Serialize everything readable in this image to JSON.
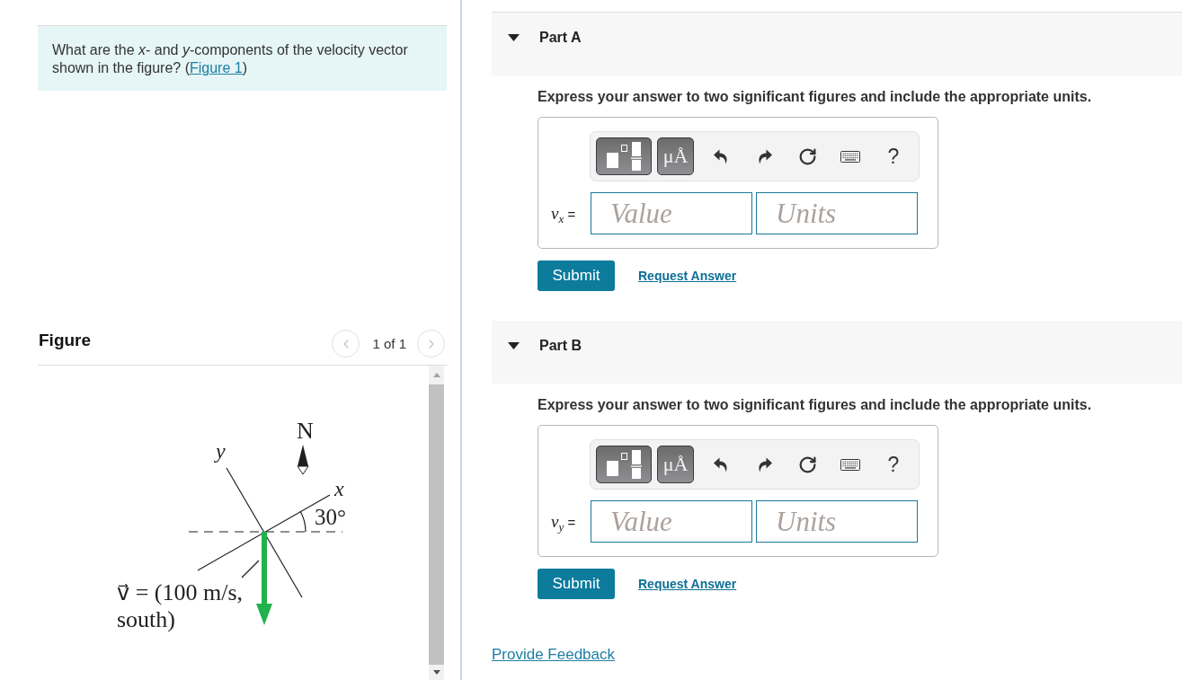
{
  "question": {
    "text_before": "What are the *x*- and *y*-components of the velocity vector shown in the figure? (",
    "link": "Figure 1",
    "text_after": ")"
  },
  "figure": {
    "title": "Figure",
    "pager": {
      "text": "1 of 1",
      "prev_disabled": true,
      "next_disabled": true
    },
    "labels": {
      "north": "N",
      "y_axis": "y",
      "x_axis": "x",
      "angle": "30°",
      "vector": {
        "symbol": "v⃗",
        "lines": [
          "= (100 m/s,",
          "south)"
        ]
      }
    }
  },
  "parts": [
    {
      "title": "Part A",
      "expanded": true,
      "instruction": "Express your answer to two significant figures and include the appropriate units.",
      "toolbar": {
        "units_button": "μÅ",
        "help_button": "?"
      },
      "answer_label": {
        "symbol": "v",
        "subscript": "x",
        "equals": "="
      },
      "value_placeholder": "Value",
      "units_placeholder": "Units",
      "submit": "Submit",
      "request_answer": "Request Answer"
    },
    {
      "title": "Part B",
      "expanded": true,
      "instruction": "Express your answer to two significant figures and include the appropriate units.",
      "toolbar": {
        "units_button": "μÅ",
        "help_button": "?"
      },
      "answer_label": {
        "symbol": "v",
        "subscript": "y",
        "equals": "="
      },
      "value_placeholder": "Value",
      "units_placeholder": "Units",
      "submit": "Submit",
      "request_answer": "Request Answer"
    }
  ],
  "feedback_link": "Provide Feedback"
}
